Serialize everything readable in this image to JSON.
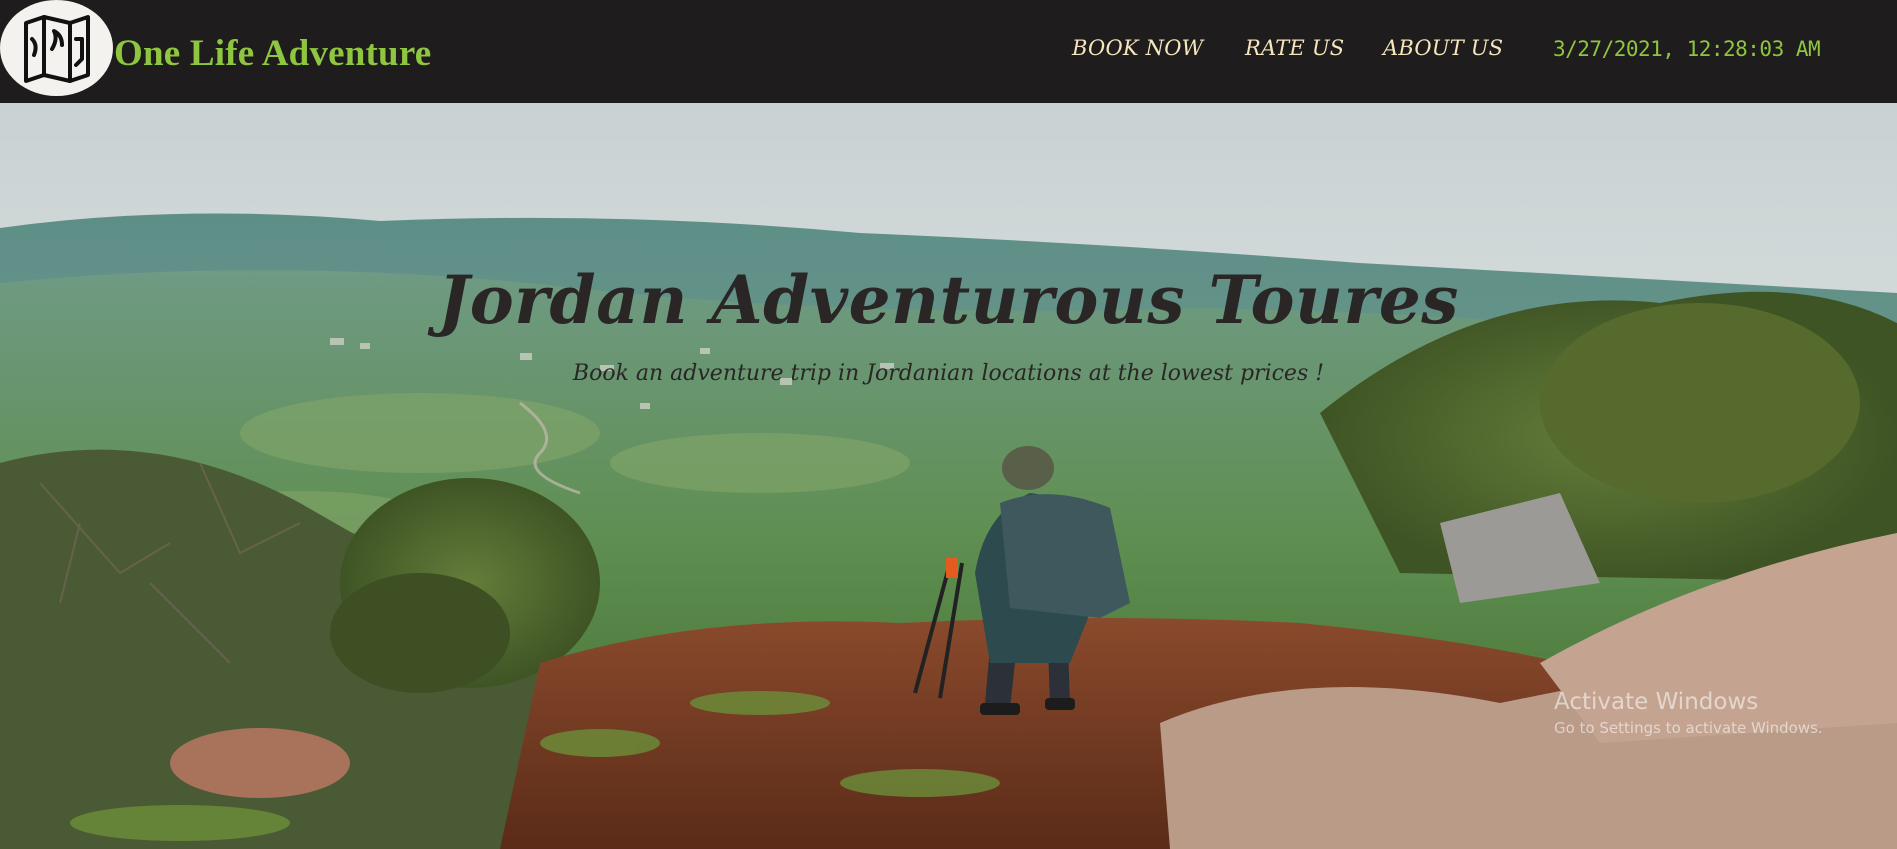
{
  "header": {
    "logo_icon": "map-icon",
    "brand_name": "One Life Adventure",
    "nav": {
      "book_now": "BOOK NOW",
      "rate_us": "RATE US",
      "about_us": "ABOUT US"
    },
    "datetime": "3/27/2021, 12:28:03 AM"
  },
  "hero": {
    "title": "Jordan Adventurous Toures",
    "subtitle": "Book an adventure trip in Jordanian locations at the lowest prices !"
  },
  "watermark": {
    "title": "Activate Windows",
    "subtitle": "Go to Settings to activate Windows."
  },
  "colors": {
    "navbar_bg": "#1e1c1d",
    "brand_green": "#8ec63f",
    "nav_link_cream": "#f6e6bd",
    "hero_text": "#2b2626"
  }
}
